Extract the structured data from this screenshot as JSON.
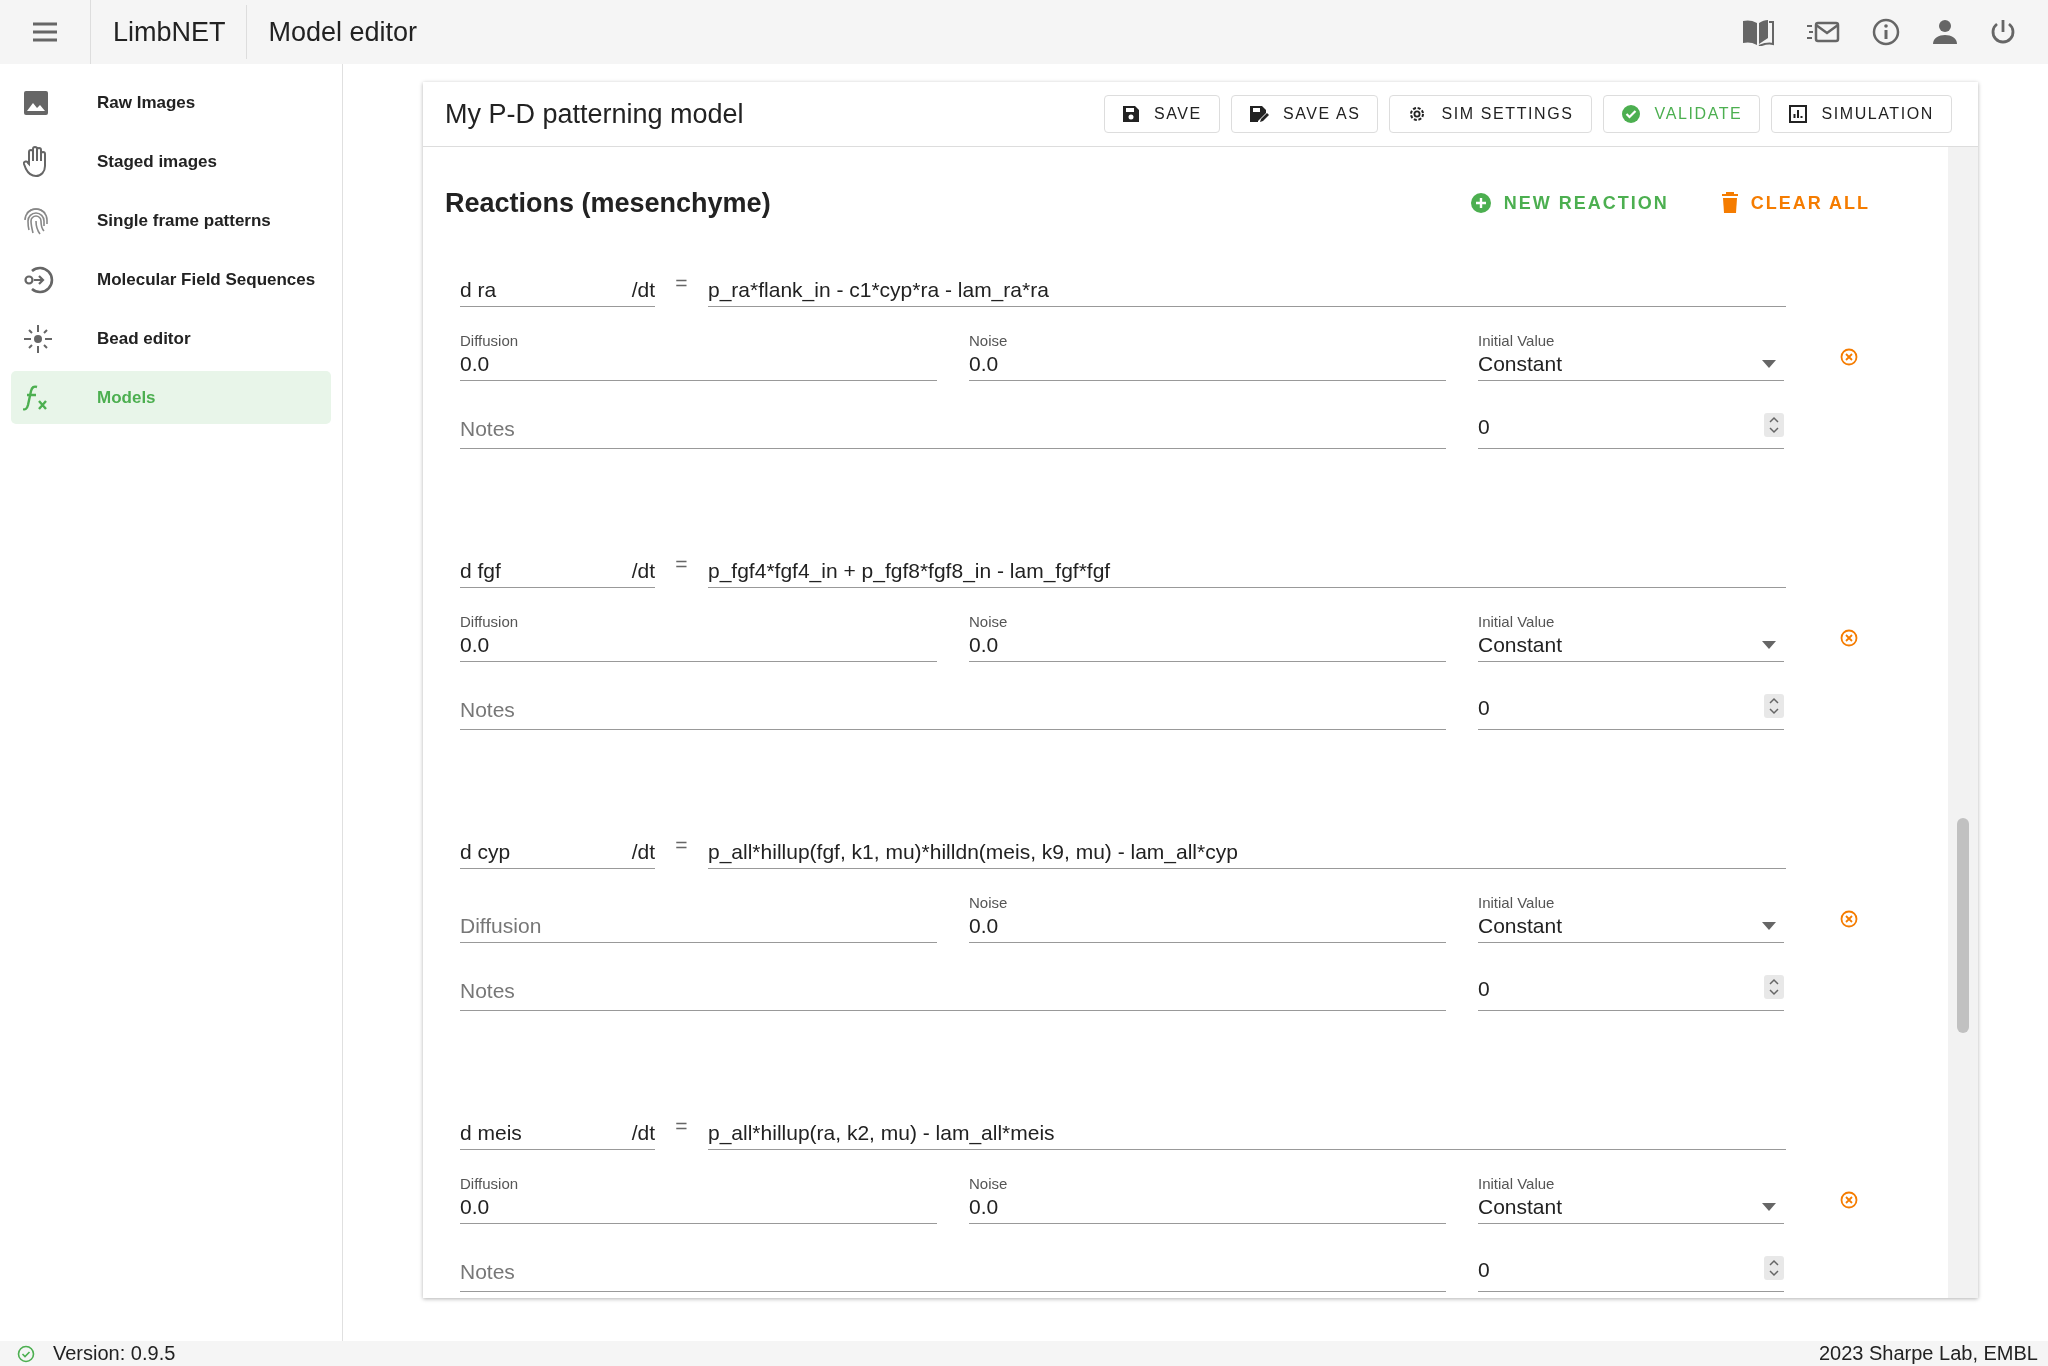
{
  "app_bar": {
    "app_name": "LimbNET",
    "page_title": "Model editor",
    "actions": [
      {
        "kind": "book"
      },
      {
        "kind": "mail"
      },
      {
        "kind": "info"
      },
      {
        "kind": "user"
      },
      {
        "kind": "power"
      }
    ]
  },
  "sidebar": {
    "items": [
      {
        "label": "Raw Images",
        "kind": "image",
        "selected": false
      },
      {
        "label": "Staged images",
        "kind": "hand",
        "selected": false
      },
      {
        "label": "Single frame patterns",
        "kind": "fingerprint",
        "selected": false
      },
      {
        "label": "Molecular Field Sequences",
        "kind": "sequence",
        "selected": false
      },
      {
        "label": "Bead editor",
        "kind": "bead",
        "selected": false
      },
      {
        "label": "Models",
        "kind": "function",
        "selected": true
      }
    ]
  },
  "editor": {
    "title": "My P-D patterning model",
    "toolbar": [
      {
        "label": "SAVE",
        "kind": "save"
      },
      {
        "label": "SAVE AS",
        "kind": "save_as"
      },
      {
        "label": "SIM SETTINGS",
        "kind": "settings"
      },
      {
        "label": "VALIDATE",
        "kind": "validate"
      },
      {
        "label": "SIMULATION",
        "kind": "simulation"
      }
    ],
    "section_title": "Reactions (mesenchyme)",
    "section_actions": [
      {
        "label": "NEW REACTION",
        "kind": "add"
      },
      {
        "label": "CLEAR ALL",
        "kind": "clear"
      }
    ],
    "reactions": [
      {
        "species": "d ra",
        "suffix": "/dt",
        "equals": "=",
        "equation": "p_ra*flank_in - c1*cyp*ra - lam_ra*ra",
        "diffusion": {
          "label": "Diffusion",
          "value": "0.0"
        },
        "noise": {
          "label": "Noise",
          "value": "0.0"
        },
        "initial": {
          "label": "Initial Value",
          "value": "Constant"
        },
        "notes": {
          "placeholder": "Notes"
        },
        "number": "0"
      },
      {
        "species": "d fgf",
        "suffix": "/dt",
        "equals": "=",
        "equation": "p_fgf4*fgf4_in + p_fgf8*fgf8_in - lam_fgf*fgf",
        "diffusion": {
          "label": "Diffusion",
          "value": "0.0"
        },
        "noise": {
          "label": "Noise",
          "value": "0.0"
        },
        "initial": {
          "label": "Initial Value",
          "value": "Constant"
        },
        "notes": {
          "placeholder": "Notes"
        },
        "number": "0"
      },
      {
        "species": "d cyp",
        "suffix": "/dt",
        "equals": "=",
        "equation": "p_all*hillup(fgf, k1, mu)*hilldn(meis, k9, mu) - lam_all*cyp",
        "diffusion": {
          "placeholder": "Diffusion"
        },
        "noise": {
          "label": "Noise",
          "value": "0.0"
        },
        "initial": {
          "label": "Initial Value",
          "value": "Constant"
        },
        "notes": {
          "placeholder": "Notes"
        },
        "number": "0"
      },
      {
        "species": "d meis",
        "suffix": "/dt",
        "equals": "=",
        "equation": "p_all*hillup(ra, k2, mu) - lam_all*meis",
        "diffusion": {
          "label": "Diffusion",
          "value": "0.0"
        },
        "noise": {
          "label": "Noise",
          "value": "0.0"
        },
        "initial": {
          "label": "Initial Value",
          "value": "Constant"
        },
        "notes": {
          "placeholder": "Notes"
        },
        "number": "0"
      }
    ]
  },
  "footer": {
    "version": "Version: 0.9.5",
    "credit": "2023 Sharpe Lab, EMBL"
  }
}
